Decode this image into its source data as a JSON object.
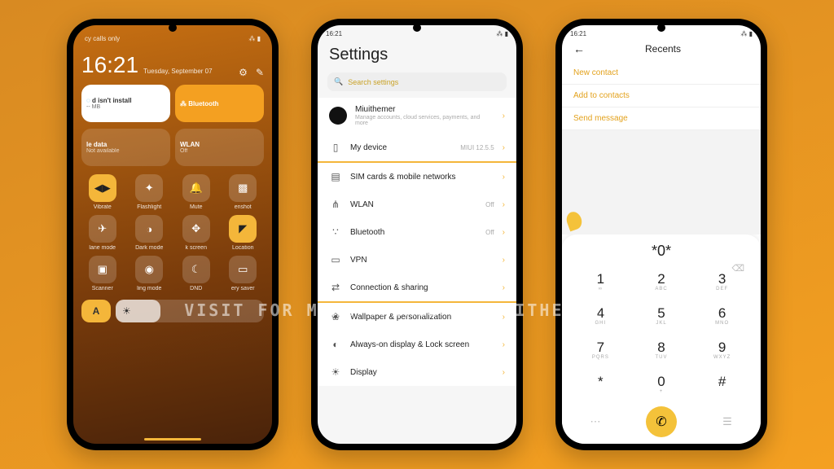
{
  "watermark": "VISIT FOR MORE THEMES - MIUITHEMER.COM",
  "statusbar": {
    "time": "16:21",
    "bt": "⁂",
    "batt": "▮▯"
  },
  "phone1": {
    "topLeft": "cy calls only",
    "clock": "16:21",
    "date": "Tuesday, September 07",
    "wide": [
      {
        "title": "d isn't install",
        "sub": "-- MB",
        "kind": "white"
      },
      {
        "title": "Bluetooth",
        "sub": "",
        "kind": "accent"
      }
    ],
    "wide2": [
      {
        "title": "le data",
        "sub": "Not available",
        "kind": "plain"
      },
      {
        "title": "WLAN",
        "sub": "Off",
        "kind": "plain"
      }
    ],
    "toggles": [
      {
        "icon": "◀▶",
        "label": "Vibrate",
        "on": true
      },
      {
        "icon": "✦",
        "label": "Flashlight",
        "on": false
      },
      {
        "icon": "🔔",
        "label": "Mute",
        "on": false
      },
      {
        "icon": "▩",
        "label": "enshot",
        "on": false
      },
      {
        "icon": "✈",
        "label": "lane mode",
        "on": false
      },
      {
        "icon": "◑",
        "label": "Dark mode",
        "on": false
      },
      {
        "icon": "✥",
        "label": "k screen",
        "on": false
      },
      {
        "icon": "◤",
        "label": "Location",
        "on": true
      },
      {
        "icon": "▣",
        "label": "Scanner",
        "on": false
      },
      {
        "icon": "◉",
        "label": "ling mode",
        "on": false
      },
      {
        "icon": "☾",
        "label": "DND",
        "on": false
      },
      {
        "icon": "▭",
        "label": "ery saver",
        "on": false
      }
    ],
    "brightnessIcon": "A",
    "sliderIcon": "☀"
  },
  "phone2": {
    "title": "Settings",
    "searchPlaceholder": "Search settings",
    "account": {
      "name": "Miuithemer",
      "sub": "Manage accounts, cloud services, payments, and more"
    },
    "device": {
      "label": "My device",
      "meta": "MIUI 12.5.5"
    },
    "group1": [
      {
        "icon": "▤",
        "label": "SIM cards & mobile networks"
      },
      {
        "icon": "⋔",
        "label": "WLAN",
        "meta": "Off"
      },
      {
        "icon": "∵",
        "label": "Bluetooth",
        "meta": "Off"
      },
      {
        "icon": "▭",
        "label": "VPN"
      },
      {
        "icon": "⇄",
        "label": "Connection & sharing"
      }
    ],
    "group2": [
      {
        "icon": "❀",
        "label": "Wallpaper & personalization"
      },
      {
        "icon": "◐",
        "label": "Always-on display & Lock screen"
      },
      {
        "icon": "☀",
        "label": "Display"
      }
    ]
  },
  "phone3": {
    "title": "Recents",
    "actions": [
      "New contact",
      "Add to contacts",
      "Send message"
    ],
    "input": "*0*",
    "keys": [
      {
        "n": "1",
        "s": "∞"
      },
      {
        "n": "2",
        "s": "ABC"
      },
      {
        "n": "3",
        "s": "DEF"
      },
      {
        "n": "4",
        "s": "GHI"
      },
      {
        "n": "5",
        "s": "JKL"
      },
      {
        "n": "6",
        "s": "MNO"
      },
      {
        "n": "7",
        "s": "PQRS"
      },
      {
        "n": "8",
        "s": "TUV"
      },
      {
        "n": "9",
        "s": "WXYZ"
      },
      {
        "n": "*",
        "s": ""
      },
      {
        "n": "0",
        "s": "+"
      },
      {
        "n": "#",
        "s": ""
      }
    ]
  }
}
